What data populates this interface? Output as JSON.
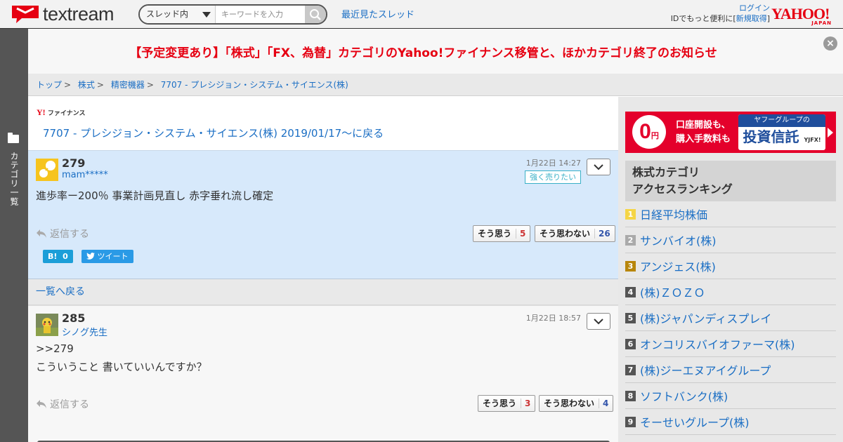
{
  "header": {
    "logo_text": "textream",
    "search_scope": "スレッド内",
    "search_placeholder": "キーワードを入力",
    "recent_threads": "最近見たスレッド",
    "login": "ログイン",
    "id_benefit": "IDでもっと便利に[",
    "register": "新規取得",
    "register_close": "]",
    "yahoo_logo": "YAHOO!",
    "yahoo_japan": "JAPAN"
  },
  "sidebar": {
    "label": "カテゴリ一覧"
  },
  "notice": {
    "text": "【予定変更あり】「株式」「FX、為替」カテゴリのYahoo!ファイナンス移管と、ほかカテゴリ終了のお知らせ",
    "close": "×"
  },
  "breadcrumb": [
    "トップ",
    "株式",
    "精密機器",
    "7707 - プレシジョン・システム・サイエンス(株)"
  ],
  "breadcrumb_sep": ">",
  "main": {
    "finance_logo_y": "Y!",
    "finance_logo_text": "ファイナンス",
    "back_link": "7707 - プレシジョン・システム・サイエンス(株) 2019/01/17〜に戻る",
    "list_back": "一覧へ戻る",
    "posts": [
      {
        "number": "279",
        "user": "mam*****",
        "time": "1月22日 14:27",
        "sentiment": "強く売りたい",
        "lines": [
          "進歩率ー200％ 事業計画見直し 赤字垂れ流し確定"
        ],
        "reply": "返信する",
        "agree_label": "そう思う",
        "agree_count": "5",
        "disagree_label": "そう思わない",
        "disagree_count": "26",
        "hatena_label": "B!",
        "hatena_count": "0",
        "tweet_label": "ツイート"
      },
      {
        "number": "285",
        "user": "シノグ先生",
        "time": "1月22日 18:57",
        "lines": [
          ">>279",
          "こういうこと 書いていいんですか？"
        ],
        "reply": "返信する",
        "agree_label": "そう思う",
        "agree_count": "3",
        "disagree_label": "そう思わない",
        "disagree_count": "4"
      }
    ]
  },
  "ad": {
    "zero": "0",
    "yen": "円",
    "line1": "口座開設も、",
    "line2": "購入手数料も",
    "box_top": "ヤフーグループの",
    "box_main": "投資信託",
    "brand": "YJFX!"
  },
  "ranking": {
    "title_line1": "株式カテゴリ",
    "title_line2": "アクセスランキング",
    "items": [
      {
        "rank": "1",
        "name": "日経平均株価",
        "color": "#f5d545"
      },
      {
        "rank": "2",
        "name": "サンバイオ(株)",
        "color": "#aaaaaa"
      },
      {
        "rank": "3",
        "name": "アンジェス(株)",
        "color": "#b8860b"
      },
      {
        "rank": "4",
        "name": "(株)ＺＯＺＯ",
        "color": "#555555"
      },
      {
        "rank": "5",
        "name": "(株)ジャパンディスプレイ",
        "color": "#555555"
      },
      {
        "rank": "6",
        "name": "オンコリスバイオファーマ(株)",
        "color": "#555555"
      },
      {
        "rank": "7",
        "name": "(株)ジーエヌアイグループ",
        "color": "#555555"
      },
      {
        "rank": "8",
        "name": "ソフトバンク(株)",
        "color": "#555555"
      },
      {
        "rank": "9",
        "name": "そーせいグループ(株)",
        "color": "#555555"
      }
    ]
  },
  "colors": {
    "accent_red": "#e60012",
    "link_blue": "#1a6ec4",
    "highlight_post": "#d7e9fb"
  }
}
